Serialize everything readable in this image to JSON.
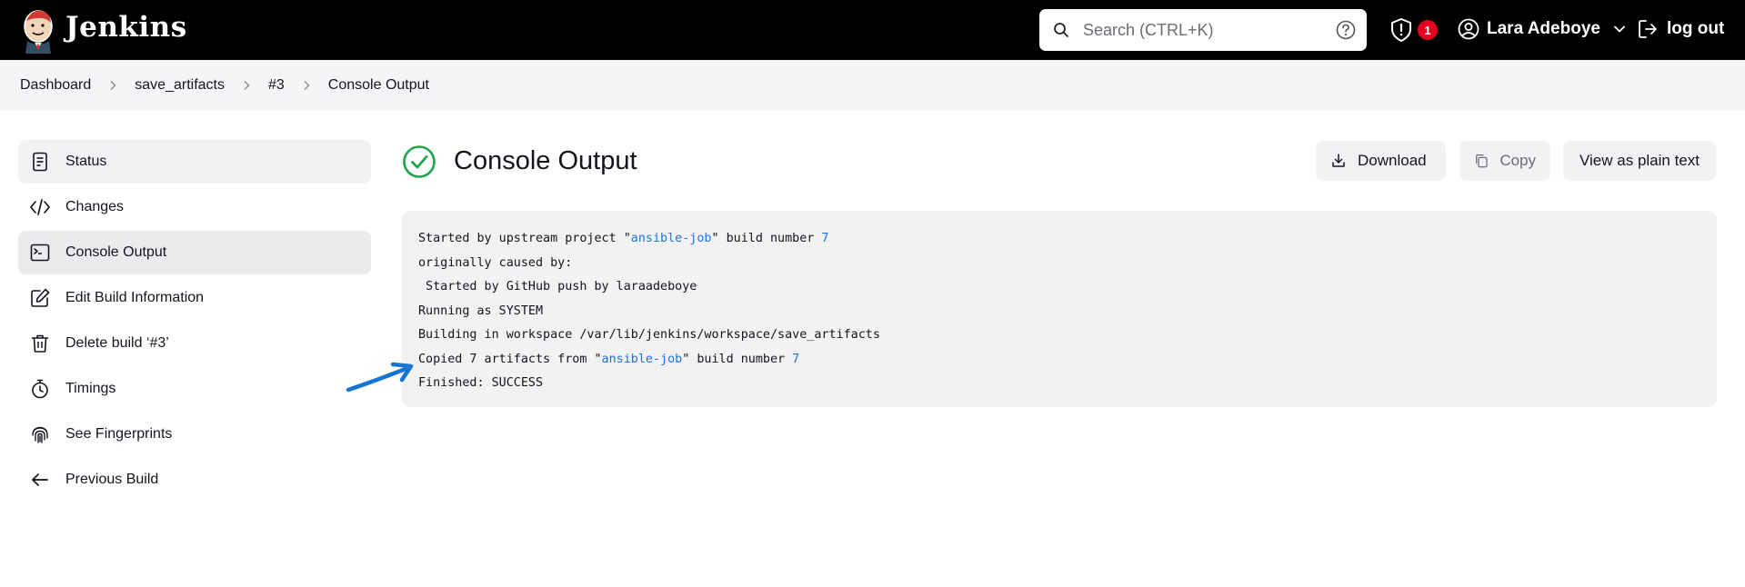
{
  "header": {
    "brand": "Jenkins",
    "search_placeholder": "Search (CTRL+K)",
    "alert_count": "1",
    "user_name": "Lara Adeboye",
    "logout_label": "log out"
  },
  "breadcrumb": [
    "Dashboard",
    "save_artifacts",
    "#3",
    "Console Output"
  ],
  "sidebar": {
    "items": [
      {
        "label": "Status",
        "icon": "document-icon"
      },
      {
        "label": "Changes",
        "icon": "code-icon"
      },
      {
        "label": "Console Output",
        "icon": "terminal-icon",
        "active": true
      },
      {
        "label": "Edit Build Information",
        "icon": "edit-icon"
      },
      {
        "label": "Delete build ‘#3’",
        "icon": "trash-icon"
      },
      {
        "label": "Timings",
        "icon": "stopwatch-icon"
      },
      {
        "label": "See Fingerprints",
        "icon": "fingerprint-icon"
      },
      {
        "label": "Previous Build",
        "icon": "arrow-left-icon"
      }
    ]
  },
  "main": {
    "title": "Console Output",
    "download_label": "Download",
    "copy_label": "Copy",
    "plain_label": "View as plain text"
  },
  "console": {
    "line1_a": "Started by upstream project \"",
    "line1_link": "ansible-job",
    "line1_b": "\" build number ",
    "line1_num": "7",
    "line2": "originally caused by:",
    "line3": " Started by GitHub push by laraadeboye",
    "line4": "Running as SYSTEM",
    "line5": "Building in workspace /var/lib/jenkins/workspace/save_artifacts",
    "line6_a": "Copied 7 artifacts from \"",
    "line6_link": "ansible-job",
    "line6_b": "\" build number ",
    "line6_num": "7",
    "line7": "Finished: SUCCESS"
  },
  "colors": {
    "header_bg": "#000000",
    "success": "#1ea64b",
    "link": "#1a73e8",
    "badge": "#e6001f",
    "annotation_arrow": "#1574d4"
  }
}
